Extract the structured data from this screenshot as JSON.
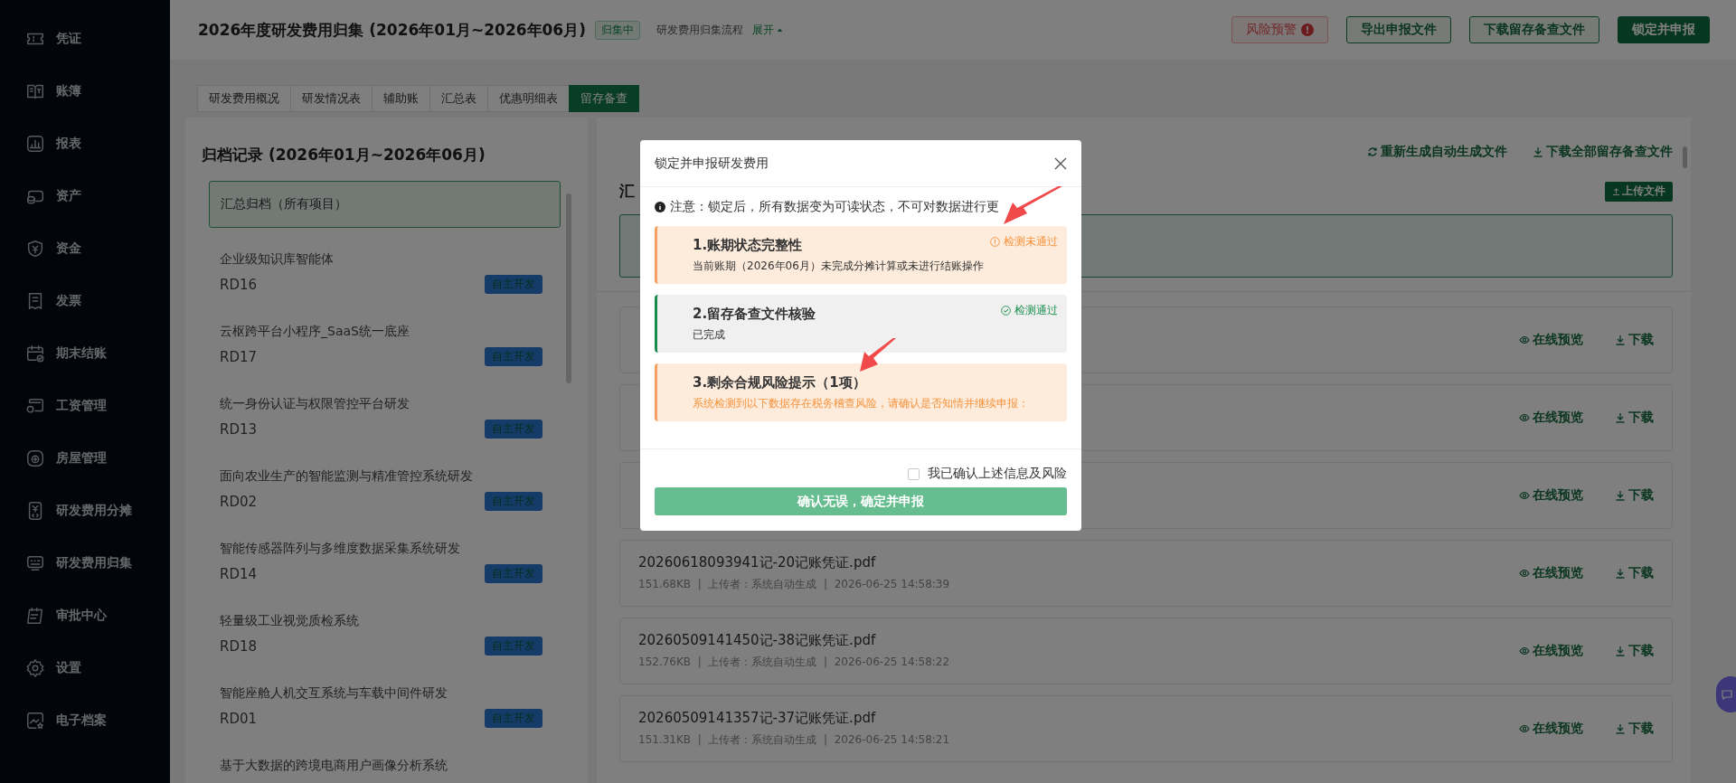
{
  "sidebar": {
    "items": [
      {
        "label": "凭证"
      },
      {
        "label": "账簿"
      },
      {
        "label": "报表"
      },
      {
        "label": "资产"
      },
      {
        "label": "资金"
      },
      {
        "label": "发票"
      },
      {
        "label": "期末结账"
      },
      {
        "label": "工资管理"
      },
      {
        "label": "房屋管理"
      },
      {
        "label": "研发费用分摊"
      },
      {
        "label": "研发费用归集"
      },
      {
        "label": "审批中心"
      },
      {
        "label": "设置"
      },
      {
        "label": "电子档案"
      }
    ]
  },
  "header": {
    "title": "2026年度研发费用归集 (2026年01月~2026年06月)",
    "status_badge": "归集中",
    "flow_label": "研发费用归集流程",
    "flow_toggle": "展开",
    "buttons": [
      {
        "label": "风险预警",
        "kind": "danger",
        "badge": "!"
      },
      {
        "label": "导出申报文件",
        "kind": "outline"
      },
      {
        "label": "下载留存备查文件",
        "kind": "outline"
      },
      {
        "label": "锁定并申报",
        "kind": "primary"
      }
    ]
  },
  "tabs": [
    {
      "label": "研发费用概况",
      "selected": false
    },
    {
      "label": "研发情况表",
      "selected": false
    },
    {
      "label": "辅助账",
      "selected": false
    },
    {
      "label": "汇总表",
      "selected": false
    },
    {
      "label": "优惠明细表",
      "selected": false
    },
    {
      "label": "留存备查",
      "selected": true
    }
  ],
  "archive": {
    "title": "归档记录 (2026年01月~2026年06月)",
    "items": [
      {
        "kind": "summary",
        "name": "汇总归档（所有项目）",
        "selected": true
      },
      {
        "kind": "project",
        "name": "企业级知识库智能体",
        "code": "RD16",
        "tag": "自主开发",
        "selected": false
      },
      {
        "kind": "project",
        "name": "云枢跨平台小程序_SaaS统一底座",
        "code": "RD17",
        "tag": "自主开发",
        "selected": false
      },
      {
        "kind": "project",
        "name": "统一身份认证与权限管控平台研发",
        "code": "RD13",
        "tag": "自主开发",
        "selected": false
      },
      {
        "kind": "project",
        "name": "面向农业生产的智能监测与精准管控系统研发",
        "code": "RD02",
        "tag": "自主开发",
        "selected": false
      },
      {
        "kind": "project",
        "name": "智能传感器阵列与多维度数据采集系统研发",
        "code": "RD14",
        "tag": "自主开发",
        "selected": false
      },
      {
        "kind": "project",
        "name": "轻量级工业视觉质检系统",
        "code": "RD18",
        "tag": "自主开发",
        "selected": false
      },
      {
        "kind": "project",
        "name": "智能座舱人机交互系统与车载中间件研发",
        "code": "RD01",
        "tag": "自主开发",
        "selected": false
      },
      {
        "kind": "project",
        "name": "基于大数据的跨境电商用户画像分析系统",
        "selected": false
      }
    ]
  },
  "main": {
    "actions": [
      {
        "kind": "refresh",
        "label": "重新生成自动生成文件"
      },
      {
        "kind": "download",
        "label": "下载全部留存备查文件"
      }
    ],
    "section_title": "汇",
    "upload_button": "上传文件",
    "files": [
      {
        "preview": "在线预览",
        "download": "下载"
      },
      {
        "preview": "在线预览",
        "download": "下载"
      },
      {
        "preview": "在线预览",
        "download": "下载"
      },
      {
        "name": "20260618093941记-20记账凭证.pdf",
        "meta": "151.68KB  |  上传者：系统自动生成  |  2026-06-25 14:58:39",
        "preview": "在线预览",
        "download": "下载"
      },
      {
        "name": "20260509141450记-38记账凭证.pdf",
        "meta": "152.76KB  |  上传者：系统自动生成  |  2026-06-25 14:58:22",
        "preview": "在线预览",
        "download": "下载"
      },
      {
        "name": "20260509141357记-37记账凭证.pdf",
        "meta": "151.31KB  |  上传者：系统自动生成  |  2026-06-25 14:58:21",
        "preview": "在线预览",
        "download": "下载"
      }
    ]
  },
  "modal": {
    "title": "锁定并申报研发费用",
    "notice": "注意：锁定后，所有数据变为可读状态，不可对数据进行更",
    "checks": [
      {
        "kind": "fail",
        "title": "1.账期状态完整性",
        "detail": "当前账期（2026年06月）未完成分摊计算或未进行结账操作",
        "status_text": "检测未通过"
      },
      {
        "kind": "pass",
        "title": "2.留存备查文件核验",
        "detail": "已完成",
        "status_text": "检测通过"
      },
      {
        "kind": "warn",
        "title": "3.剩余合规风险提示（1项）",
        "detail": "系统检测到以下数据存在税务稽查风险，请确认是否知情并继续申报："
      }
    ],
    "confirm_label": "我已确认上述信息及风险",
    "confirmed": false,
    "submit_button": {
      "label": "确认无误，确定并申报",
      "disabled": true
    }
  }
}
